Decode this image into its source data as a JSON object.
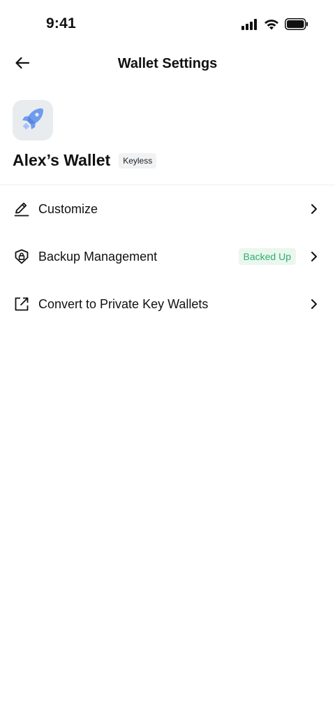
{
  "status_bar": {
    "time": "9:41"
  },
  "header": {
    "title": "Wallet Settings"
  },
  "wallet": {
    "name": "Alex’s Wallet",
    "tag": "Keyless",
    "avatar_icon": "rocket-icon"
  },
  "menu": {
    "items": [
      {
        "label": "Customize",
        "icon": "pencil-icon"
      },
      {
        "label": "Backup Management",
        "icon": "shield-lock-icon",
        "badge": "Backed Up"
      },
      {
        "label": "Convert to Private Key Wallets",
        "icon": "external-link-icon"
      }
    ]
  },
  "colors": {
    "badge_text": "#2fae6d",
    "badge_bg": "#eaf7ef",
    "avatar_bg": "#e9ecef",
    "rocket": "#6f9bf0"
  }
}
